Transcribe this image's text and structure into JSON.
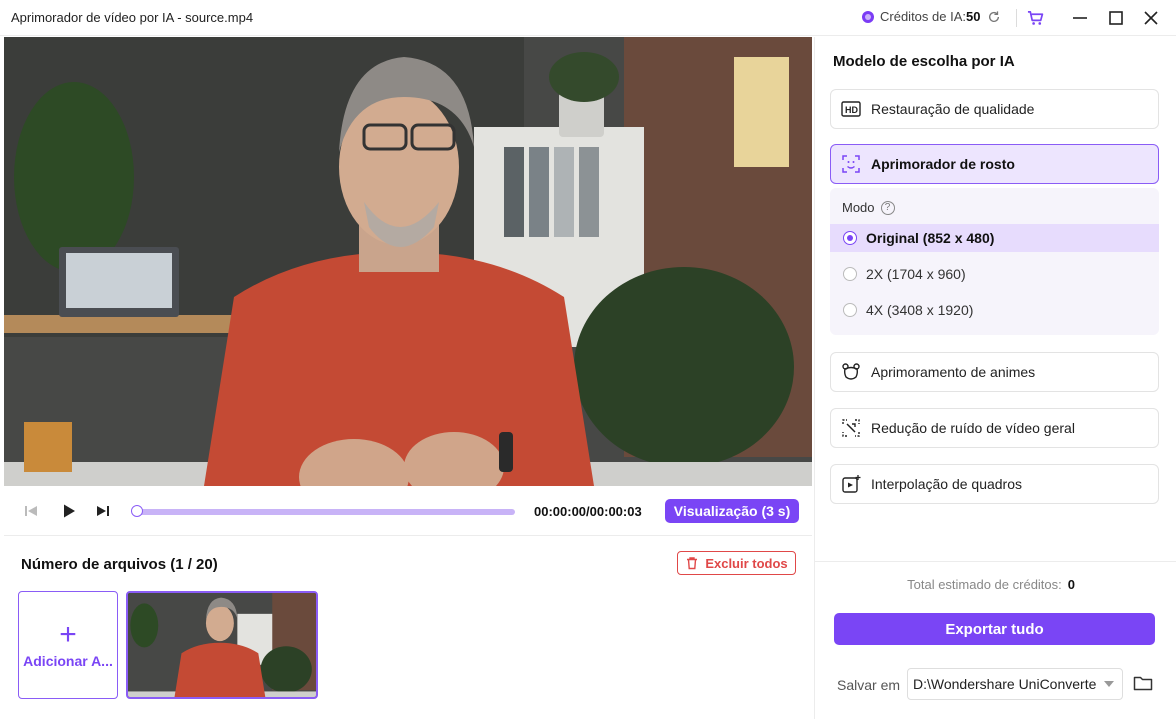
{
  "window": {
    "title": "Aprimorador de vídeo por IA - source.mp4",
    "credits_label": "Créditos de IA:",
    "credits_value": "50"
  },
  "player": {
    "timecode": "00:00:00/00:00:03",
    "preview_label": "Visualização (3 s)",
    "progress": 0
  },
  "files": {
    "title": "Número de arquivos (1 / 20)",
    "delete_all_label": "Excluir todos",
    "add_label": "Adicionar A..."
  },
  "panel": {
    "title": "Modelo de escolha por IA",
    "models": [
      {
        "label": "Restauração de qualidade",
        "icon": "hd-icon"
      },
      {
        "label": "Aprimorador de rosto",
        "icon": "face-scan-icon",
        "selected": true
      },
      {
        "label": "Aprimoramento de animes",
        "icon": "bear-icon"
      },
      {
        "label": "Redução de ruído de vídeo geral",
        "icon": "denoise-icon"
      },
      {
        "label": "Interpolação de quadros",
        "icon": "frame-interpolation-icon"
      }
    ],
    "mode_label": "Modo",
    "modes": [
      {
        "label": "Original (852 x 480)",
        "selected": true
      },
      {
        "label": "2X (1704 x 960)",
        "selected": false
      },
      {
        "label": "4X (3408 x 1920)",
        "selected": false
      }
    ],
    "total_label": "Total estimado de créditos:",
    "total_value": "0",
    "export_label": "Exportar tudo",
    "save_label": "Salvar em",
    "save_path": "D:\\Wondershare UniConverte"
  },
  "colors": {
    "accent": "#7a45f5",
    "accent_light": "#ede5fe",
    "danger": "#e04848"
  }
}
